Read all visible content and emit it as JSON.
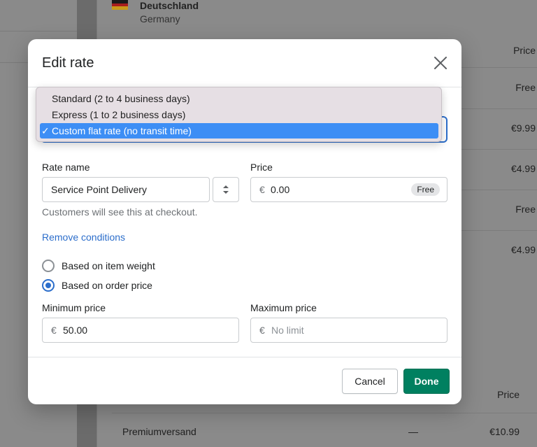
{
  "background": {
    "country_name": "Deutschland",
    "country_sub": "Germany",
    "price_header": "Price",
    "rows": [
      {
        "price": "Free"
      },
      {
        "price": "€9.99"
      },
      {
        "price": "€4.99"
      },
      {
        "price": "Free"
      },
      {
        "price": "€4.99"
      }
    ],
    "price_header_2": "Price",
    "premium_name": "Premiumversand",
    "premium_transit": "—",
    "premium_price": "€10.99"
  },
  "modal": {
    "title": "Edit rate",
    "rate_type_options": [
      {
        "label": "Standard (2 to 4 business days)",
        "selected": false
      },
      {
        "label": "Express (1 to 2 business days)",
        "selected": false
      },
      {
        "label": "Custom flat rate (no transit time)",
        "selected": true
      }
    ],
    "check_mark": "✓",
    "rate_name": {
      "label": "Rate name",
      "value": "Service Point Delivery",
      "help": "Customers will see this at checkout."
    },
    "price": {
      "label": "Price",
      "currency": "€",
      "value": "0.00",
      "badge": "Free"
    },
    "remove_conditions": "Remove conditions",
    "condition_options": [
      {
        "label": "Based on item weight",
        "checked": false
      },
      {
        "label": "Based on order price",
        "checked": true
      }
    ],
    "min_price": {
      "label": "Minimum price",
      "currency": "€",
      "value": "50.00"
    },
    "max_price": {
      "label": "Maximum price",
      "currency": "€",
      "placeholder": "No limit"
    },
    "cancel_label": "Cancel",
    "done_label": "Done"
  },
  "colors": {
    "primary": "#008060",
    "link": "#2c6ecb",
    "menu_highlight": "#3d8ef5"
  }
}
